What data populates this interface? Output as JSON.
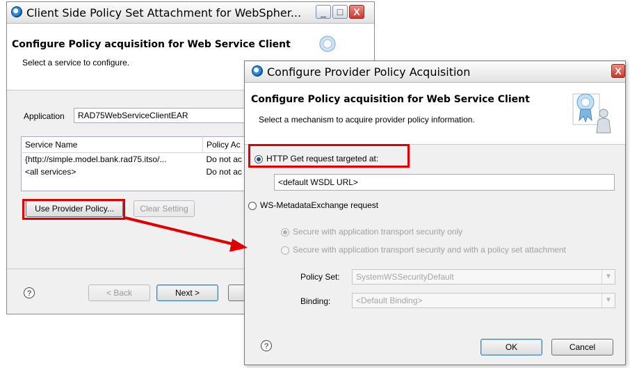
{
  "back_window": {
    "title": "Client Side Policy Set Attachment for WebSpher...",
    "header_title": "Configure Policy acquisition for Web Service Client",
    "header_subtitle": "Select a service to configure.",
    "application_label": "Application",
    "application_value": "RAD75WebServiceClientEAR",
    "table": {
      "columns": [
        "Service Name",
        "Policy Ac"
      ],
      "rows": [
        [
          "{http://simple.model.bank.rad75.itso/...",
          "Do not ac"
        ],
        [
          "<all services>",
          "Do not ac"
        ]
      ]
    },
    "use_provider_button": "Use Provider Policy...",
    "clear_setting_button": "Clear Setting",
    "help_symbol": "?",
    "back_button": "< Back",
    "next_button": "Next >"
  },
  "front_window": {
    "title": "Configure Provider Policy Acquisition",
    "header_title": "Configure Policy acquisition for Web Service Client",
    "header_subtitle": "Select a mechanism to acquire provider policy information.",
    "http_get_label": "HTTP Get request targeted at:",
    "wsdl_url_value": "<default WSDL URL>",
    "ws_metadata_label": "WS-MetadataExchange request",
    "secure_transport_only": "Secure with application transport security only",
    "secure_transport_policy": "Secure with application transport security and with a policy set attachment",
    "policy_set_label": "Policy Set:",
    "policy_set_value": "SystemWSSecurityDefault",
    "binding_label": "Binding:",
    "binding_value": "<Default Binding>",
    "help_symbol": "?",
    "ok_button": "OK",
    "cancel_button": "Cancel"
  },
  "window_controls": {
    "minimize": "_",
    "maximize": "□",
    "close": "X"
  },
  "colors": {
    "highlight": "#e10000",
    "body_bg": "#f0f0f0",
    "title_bg": "#e2e2e2"
  },
  "icons": [
    "wizard-banner-icon",
    "window-icon",
    "help-icon",
    "arrow-annotation"
  ]
}
